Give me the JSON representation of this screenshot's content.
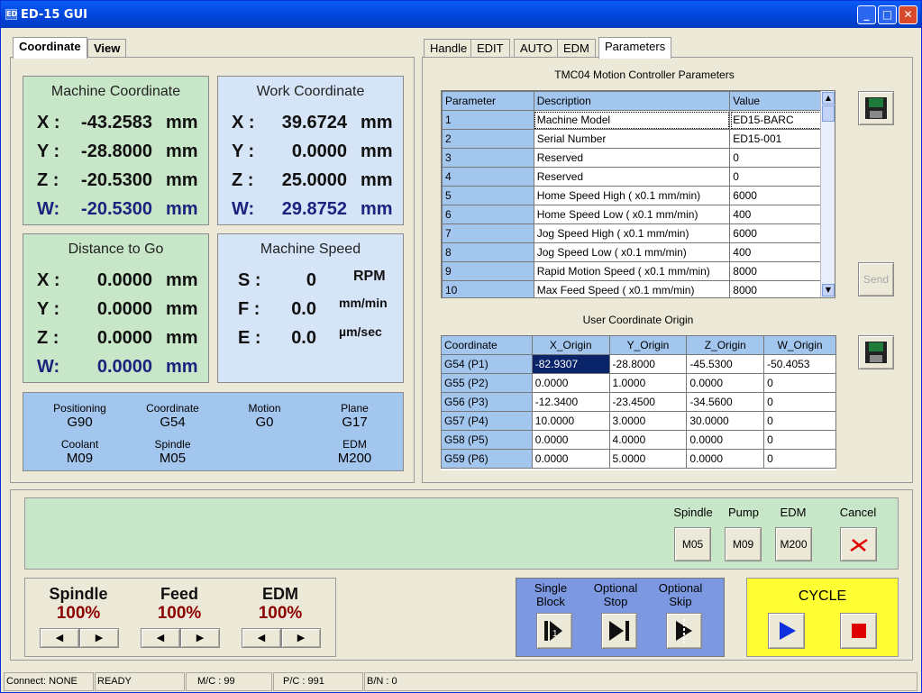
{
  "window": {
    "title": "ED-15 GUI",
    "app_icon": "app-icon"
  },
  "left_tabs": [
    "Coordinate",
    "View"
  ],
  "machine": {
    "title": "Machine Coordinate",
    "axes": [
      {
        "axis": "X :",
        "value": "-43.2583",
        "unit": "mm"
      },
      {
        "axis": "Y :",
        "value": "-28.8000",
        "unit": "mm"
      },
      {
        "axis": "Z :",
        "value": "-20.5300",
        "unit": "mm"
      },
      {
        "axis": "W:",
        "value": "-20.5300",
        "unit": "mm"
      }
    ]
  },
  "work": {
    "title": "Work Coordinate",
    "axes": [
      {
        "axis": "X :",
        "value": "39.6724",
        "unit": "mm"
      },
      {
        "axis": "Y :",
        "value": "0.0000",
        "unit": "mm"
      },
      {
        "axis": "Z :",
        "value": "25.0000",
        "unit": "mm"
      },
      {
        "axis": "W:",
        "value": "29.8752",
        "unit": "mm"
      }
    ]
  },
  "dtg": {
    "title": "Distance to Go",
    "axes": [
      {
        "axis": "X :",
        "value": "0.0000",
        "unit": "mm"
      },
      {
        "axis": "Y :",
        "value": "0.0000",
        "unit": "mm"
      },
      {
        "axis": "Z :",
        "value": "0.0000",
        "unit": "mm"
      },
      {
        "axis": "W:",
        "value": "0.0000",
        "unit": "mm"
      }
    ]
  },
  "speed": {
    "title": "Machine Speed",
    "rows": [
      {
        "axis": "S :",
        "value": "0",
        "unit": "RPM"
      },
      {
        "axis": "F :",
        "value": "0.0",
        "unit": "mm/min"
      },
      {
        "axis": "E :",
        "value": "0.0",
        "unit": "µm/sec"
      }
    ]
  },
  "modal": [
    {
      "label": "Positioning",
      "value": "G90"
    },
    {
      "label": "Coordinate",
      "value": "G54"
    },
    {
      "label": "Motion",
      "value": "G0"
    },
    {
      "label": "Plane",
      "value": "G17"
    },
    {
      "label": "Coolant",
      "value": "M09"
    },
    {
      "label": "Spindle",
      "value": "M05"
    },
    {
      "label": "EDM",
      "value": "M200"
    }
  ],
  "right_tabs": [
    "Handle",
    "EDIT",
    "AUTO",
    "EDM",
    "Parameters"
  ],
  "params": {
    "title": "TMC04 Motion Controller Parameters",
    "headers": [
      "Parameter",
      "Description",
      "Value"
    ],
    "rows": [
      [
        "1",
        "Machine Model",
        "ED15-BARC"
      ],
      [
        "2",
        "Serial Number",
        "ED15-001"
      ],
      [
        "3",
        "Reserved",
        "0"
      ],
      [
        "4",
        "Reserved",
        "0"
      ],
      [
        "5",
        "Home Speed High ( x0.1 mm/min)",
        "6000"
      ],
      [
        "6",
        "Home Speed Low ( x0.1 mm/min)",
        "400"
      ],
      [
        "7",
        "Jog Speed High ( x0.1 mm/min)",
        "6000"
      ],
      [
        "8",
        "Jog Speed Low ( x0.1 mm/min)",
        "400"
      ],
      [
        "9",
        "Rapid Motion Speed ( x0.1 mm/min)",
        "8000"
      ],
      [
        "10",
        "Max Feed Speed ( x0.1 mm/min)",
        "8000"
      ]
    ],
    "send_label": "Send"
  },
  "origin": {
    "title": "User Coordinate Origin",
    "headers": [
      "Coordinate",
      "X_Origin",
      "Y_Origin",
      "Z_Origin",
      "W_Origin"
    ],
    "rows": [
      [
        "G54 (P1)",
        "-82.9307",
        "-28.8000",
        "-45.5300",
        "-50.4053"
      ],
      [
        "G55 (P2)",
        "0.0000",
        "1.0000",
        "0.0000",
        "0"
      ],
      [
        "G56 (P3)",
        "-12.3400",
        "-23.4500",
        "-34.5600",
        "0"
      ],
      [
        "G57 (P4)",
        "10.0000",
        "3.0000",
        "30.0000",
        "0"
      ],
      [
        "G58 (P5)",
        "0.0000",
        "4.0000",
        "0.0000",
        "0"
      ],
      [
        "G59 (P6)",
        "0.0000",
        "5.0000",
        "0.0000",
        "0"
      ]
    ]
  },
  "mcode": {
    "spindle": {
      "label": "Spindle",
      "button": "M05"
    },
    "pump": {
      "label": "Pump",
      "button": "M09"
    },
    "edm": {
      "label": "EDM",
      "button": "M200"
    },
    "cancel": {
      "label": "Cancel"
    }
  },
  "override": [
    {
      "title": "Spindle",
      "percent": "100%"
    },
    {
      "title": "Feed",
      "percent": "100%"
    },
    {
      "title": "EDM",
      "percent": "100%"
    }
  ],
  "exec_opts": [
    {
      "label1": "Single",
      "label2": "Block"
    },
    {
      "label1": "Optional",
      "label2": "Stop"
    },
    {
      "label1": "Optional",
      "label2": "Skip"
    }
  ],
  "cycle": {
    "title": "CYCLE"
  },
  "status": {
    "connect": "Connect: NONE",
    "state": "READY",
    "mc": "M/C : 99",
    "pc": "P/C : 991",
    "bn": "B/N : 0"
  },
  "colors": {
    "title_bar": "#0044d8",
    "green_panel": "#c8e6c8",
    "blue_panel": "#d6e4f7",
    "grid_header": "#a3c6ef",
    "cycle_panel": "#ffff33",
    "exec_panel": "#7b98e0",
    "percent": "#8b0000",
    "cancel_x": "#e00000",
    "stop_square": "#e00000",
    "start_arrow": "#1030e0"
  }
}
